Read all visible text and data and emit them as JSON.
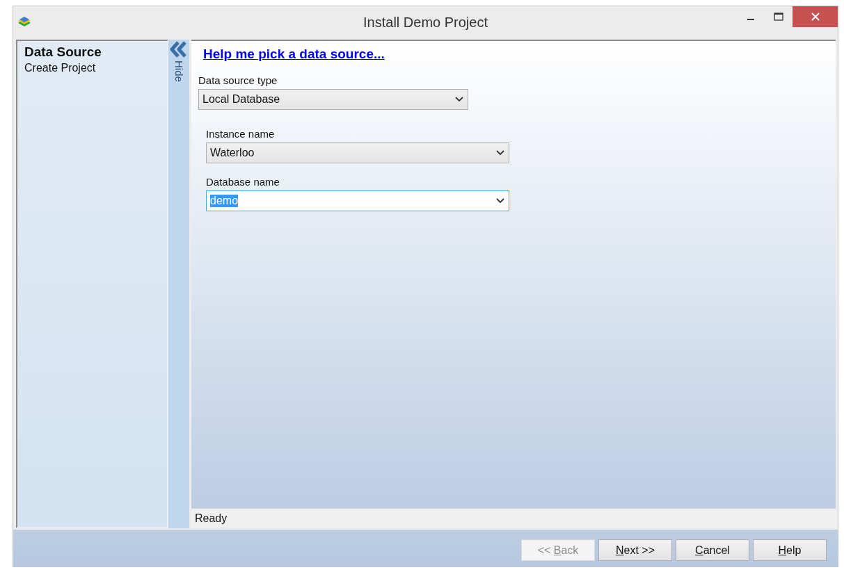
{
  "window": {
    "title": "Install Demo Project"
  },
  "steps": [
    {
      "label": "Data Source",
      "selected": true
    },
    {
      "label": "Create Project",
      "selected": false
    }
  ],
  "hide_tab": {
    "label": "Hide"
  },
  "help_link": "Help me pick a data source...",
  "data_source_type": {
    "label": "Data source type",
    "value": "Local Database"
  },
  "instance": {
    "label": "Instance name",
    "value": "Waterloo"
  },
  "database": {
    "label": "Database name",
    "value": "demo",
    "focused": true
  },
  "status_bar": "Ready",
  "buttons": [
    {
      "before": "<< ",
      "access_key": "B",
      "after": "ack",
      "disabled": true
    },
    {
      "access_key": "N",
      "after": "ext >>",
      "disabled": false
    },
    {
      "access_key": "C",
      "after": "ancel",
      "disabled": false
    },
    {
      "access_key": "H",
      "after": "elp",
      "disabled": false
    }
  ]
}
